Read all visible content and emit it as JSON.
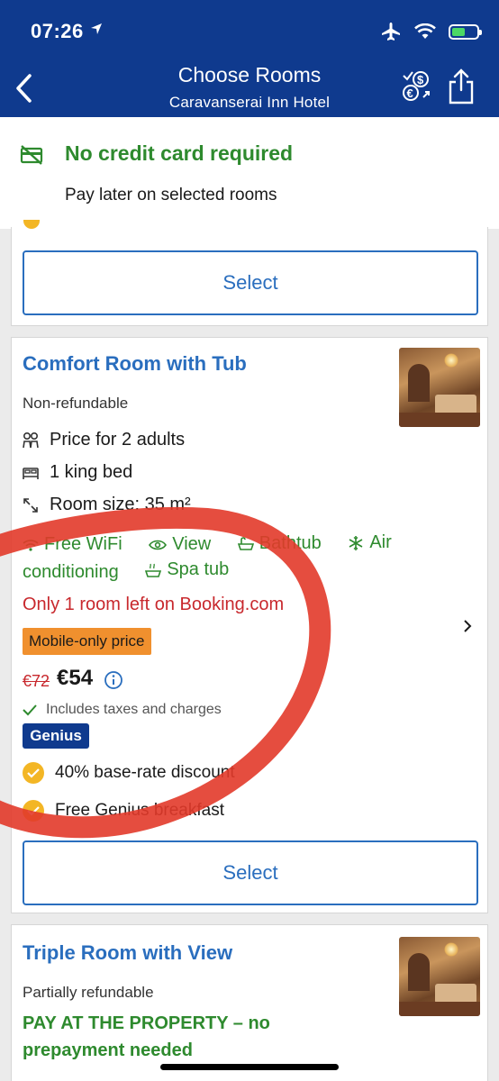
{
  "status_bar": {
    "time": "07:26"
  },
  "header": {
    "title": "Choose Rooms",
    "subtitle": "Caravanserai Inn Hotel",
    "back_icon": "chevron-left-icon",
    "currency_icon": "currency-exchange-icon",
    "share_icon": "share-icon"
  },
  "banner": {
    "title": "No credit card required",
    "subtitle": "Pay later on selected rooms"
  },
  "rooms": [
    {
      "select_label": "Select"
    },
    {
      "name": "Comfort Room with Tub",
      "refund_policy": "Non-refundable",
      "occupancy": "Price for 2 adults",
      "bed": "1 king bed",
      "size": "Room size: 35 m²",
      "amenities_line1": [
        "Free WiFi",
        "View",
        "Bathtub",
        "Air"
      ],
      "amenities_line2": [
        "conditioning",
        "Spa tub"
      ],
      "scarcity": "Only 1 room left on Booking.com",
      "badge": "Mobile-only price",
      "old_price": "€72",
      "price": "€54",
      "taxes": "Includes taxes and charges",
      "genius_label": "Genius",
      "perks": [
        "40% base-rate discount",
        "Free Genius breakfast"
      ],
      "select_label": "Select"
    },
    {
      "name": "Triple Room with View",
      "refund_policy": "Partially refundable",
      "payment_note": "PAY AT THE PROPERTY – no prepayment needed"
    }
  ],
  "colors": {
    "brand_blue": "#0f3a8e",
    "link_blue": "#2a6ebe",
    "green": "#2e8a2e",
    "red": "#c8282d",
    "badge_orange": "#f0902e",
    "genius_yellow": "#f3b625",
    "annotation_red": "#e23a2a"
  }
}
